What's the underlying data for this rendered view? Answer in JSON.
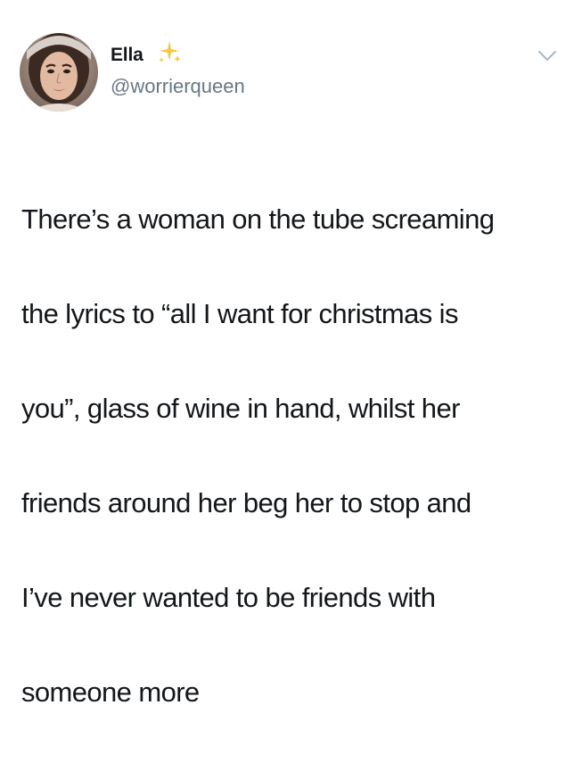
{
  "tweet": {
    "display_name": "Ella",
    "handle": "@worrierqueen",
    "badge_icon": "sparkles-icon",
    "menu_icon": "chevron-down-icon",
    "text_lines": [
      "There’s a woman on the tube screaming",
      "the lyrics to “all I want for christmas is",
      "you”, glass of wine in hand, whilst her",
      "friends around her beg her to stop and",
      "I’ve never wanted to be friends with",
      "someone more"
    ]
  },
  "colors": {
    "text": "#14171a",
    "secondary_text": "#657786",
    "sparkle": "#f5c842",
    "background": "#ffffff"
  }
}
